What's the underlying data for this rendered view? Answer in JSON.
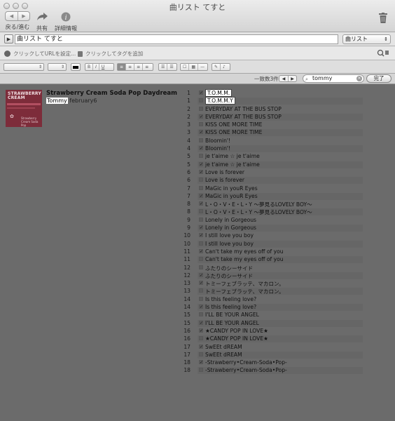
{
  "window": {
    "title": "曲リスト てすと"
  },
  "toolbar": {
    "back_forward_label": "戻る/進む",
    "share_label": "共有",
    "info_label": "詳細情報"
  },
  "pathbar": {
    "path": "曲リスト てすと",
    "mode": "曲リスト"
  },
  "urlrow": {
    "url_hint": "クリックしてURLを設定...",
    "tag_hint": "クリックしてタグを追加"
  },
  "search": {
    "match_count": "一致数3件",
    "query": "tommy",
    "done_label": "完了"
  },
  "album": {
    "title": "Strawberry Cream Soda Pop Daydream",
    "artist_highlight": "Tommy",
    "artist_rest": " february6",
    "art_text": "STRAWBERRY CREAM",
    "art_sub": "Strawberry Cream Soda Pop"
  },
  "tracks": [
    {
      "num": "1",
      "checked": true,
      "name": "T.O.M.M.",
      "highlight": true
    },
    {
      "num": "1",
      "checked": false,
      "name": "T.O.M.M.Y",
      "highlight": true
    },
    {
      "num": "2",
      "checked": false,
      "name": "EVERYDAY AT THE BUS STOP",
      "highlight": false
    },
    {
      "num": "2",
      "checked": true,
      "name": "EVERYDAY AT THE BUS STOP",
      "highlight": false
    },
    {
      "num": "3",
      "checked": false,
      "name": "KISS ONE MORE TIME",
      "highlight": false
    },
    {
      "num": "3",
      "checked": true,
      "name": "KISS ONE MORE TIME",
      "highlight": false
    },
    {
      "num": "4",
      "checked": false,
      "name": "Bloomin'!",
      "highlight": false
    },
    {
      "num": "4",
      "checked": true,
      "name": "Bloomin'!",
      "highlight": false
    },
    {
      "num": "5",
      "checked": false,
      "name": "je t'aime ☆ je t'aime",
      "highlight": false
    },
    {
      "num": "5",
      "checked": true,
      "name": "je t'aime ☆ je t'aime",
      "highlight": false
    },
    {
      "num": "6",
      "checked": true,
      "name": "Love is forever",
      "highlight": false
    },
    {
      "num": "6",
      "checked": false,
      "name": "Love is forever",
      "highlight": false
    },
    {
      "num": "7",
      "checked": false,
      "name": "MaGic in youR Eyes",
      "highlight": false
    },
    {
      "num": "7",
      "checked": true,
      "name": "MaGic in youR Eyes",
      "highlight": false
    },
    {
      "num": "8",
      "checked": true,
      "name": "L・O・V・E・L・Y ～夢見るLOVELY BOY～",
      "highlight": false
    },
    {
      "num": "8",
      "checked": false,
      "name": "L・O・V・E・L・Y ～夢見るLOVELY BOY～",
      "highlight": false
    },
    {
      "num": "9",
      "checked": false,
      "name": "Lonely in Gorgeous",
      "highlight": false
    },
    {
      "num": "9",
      "checked": true,
      "name": "Lonely in Gorgeous",
      "highlight": false
    },
    {
      "num": "10",
      "checked": true,
      "name": "I still love you boy",
      "highlight": false
    },
    {
      "num": "10",
      "checked": false,
      "name": "I still love you boy",
      "highlight": false
    },
    {
      "num": "11",
      "checked": true,
      "name": "Can't take my eyes off of you",
      "highlight": false
    },
    {
      "num": "11",
      "checked": false,
      "name": "Can't take my eyes off of you",
      "highlight": false
    },
    {
      "num": "12",
      "checked": false,
      "name": "ふたりのシーサイド",
      "highlight": false
    },
    {
      "num": "12",
      "checked": true,
      "name": "ふたりのシーサイド",
      "highlight": false
    },
    {
      "num": "13",
      "checked": true,
      "name": "トミーフェブラッテ、マカロン。",
      "highlight": false
    },
    {
      "num": "13",
      "checked": false,
      "name": "トミーフェブラッテ、マカロン。",
      "highlight": false
    },
    {
      "num": "14",
      "checked": false,
      "name": "Is this feeling love?",
      "highlight": false
    },
    {
      "num": "14",
      "checked": true,
      "name": "Is this feeling love?",
      "highlight": false
    },
    {
      "num": "15",
      "checked": false,
      "name": "I'LL BE YOUR ANGEL",
      "highlight": false
    },
    {
      "num": "15",
      "checked": true,
      "name": "I'LL BE YOUR ANGEL",
      "highlight": false
    },
    {
      "num": "16",
      "checked": true,
      "name": "★CANDY POP IN LOVE★",
      "highlight": false
    },
    {
      "num": "16",
      "checked": false,
      "name": "★CANDY POP IN LOVE★",
      "highlight": false
    },
    {
      "num": "17",
      "checked": true,
      "name": "SwEEt dREAM",
      "highlight": false
    },
    {
      "num": "17",
      "checked": false,
      "name": "SwEEt dREAM",
      "highlight": false
    },
    {
      "num": "18",
      "checked": true,
      "name": "-Strawberry•Cream-Soda•Pop-",
      "highlight": false
    },
    {
      "num": "18",
      "checked": false,
      "name": "-Strawberry•Cream-Soda•Pop-",
      "highlight": false
    }
  ]
}
